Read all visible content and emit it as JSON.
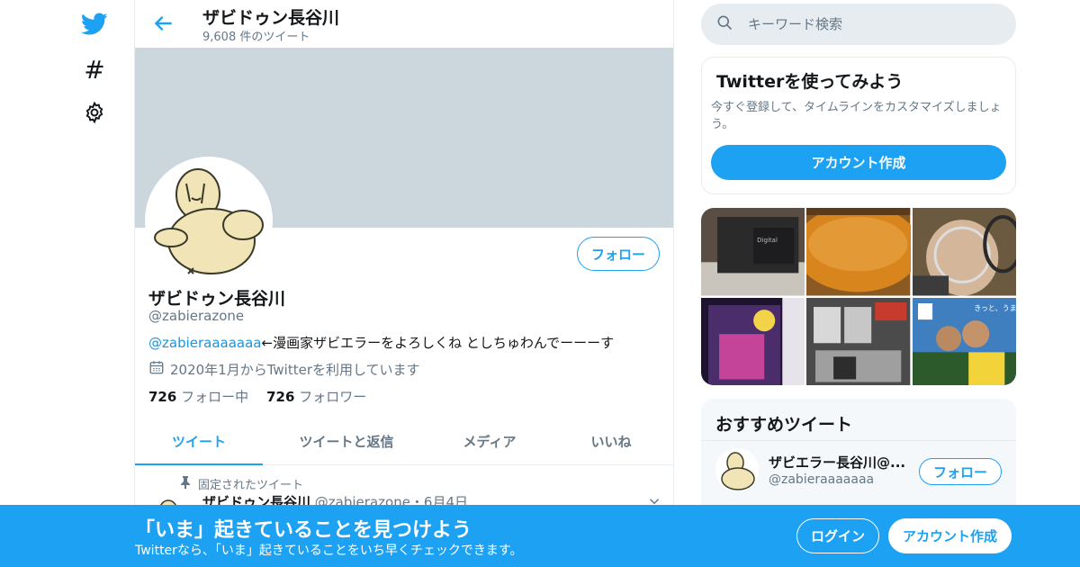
{
  "nav": {
    "items": [
      {
        "icon": "twitter-bird-icon"
      },
      {
        "icon": "hashtag-icon",
        "glyph": "#"
      },
      {
        "icon": "gear-icon"
      }
    ]
  },
  "header": {
    "name": "ザビドゥン長谷川",
    "tweet_count": "9,608 件のツイート"
  },
  "profile": {
    "name": "ザビドゥン長谷川",
    "handle": "@zabierazone",
    "follow_label": "フォロー",
    "bio_link": "@zabieraaaaaaa",
    "bio_text": "←漫画家ザビエラーをよろしくね としちゅわんでーーーす",
    "joined": "2020年1月からTwitterを利用しています",
    "following_count": "726",
    "following_label": "フォロー中",
    "followers_count": "726",
    "followers_label": "フォロワー"
  },
  "tabs": [
    {
      "label": "ツイート",
      "active": true
    },
    {
      "label": "ツイートと返信",
      "active": false
    },
    {
      "label": "メディア",
      "active": false
    },
    {
      "label": "いいね",
      "active": false
    }
  ],
  "pinned_tweet": {
    "pinned_label": "固定されたツイート",
    "author": "ザビドゥン長谷川",
    "meta": "@zabierazone・6月4日"
  },
  "search": {
    "placeholder": "キーワード検索"
  },
  "signup_card": {
    "title": "Twitterを使ってみよう",
    "text": "今すぐ登録して、タイムラインをカスタマイズしましょう。",
    "button": "アカウント作成"
  },
  "recommended": {
    "title": "おすすめツイート",
    "name": "ザビエラー長谷川@...",
    "handle": "@zabieraaaaaaa",
    "follow_label": "フォロー"
  },
  "bottom_bar": {
    "title": "「いま」起きていることを見つけよう",
    "subtitle": "Twitterなら、「いま」起きていることをいち早くチェックできます。",
    "login": "ログイン",
    "signup": "アカウント作成"
  },
  "colors": {
    "accent": "#1da1f2",
    "banner": "#ccd6dd",
    "muted": "#657786"
  }
}
